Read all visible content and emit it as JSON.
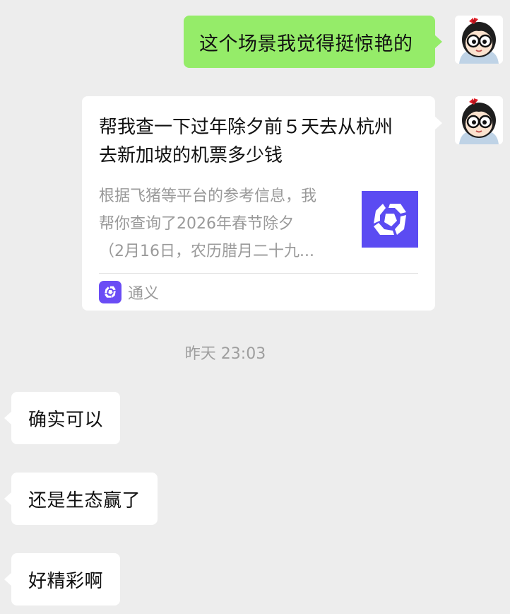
{
  "messages": {
    "outgoing_text": "这个场景我觉得挺惊艳的",
    "shared_card": {
      "title_line1": "帮我查一下过年除夕前５天去从杭州",
      "title_line2": "去新加坡的机票多少钱",
      "desc_line1": "根据飞猪等平台的参考信息，我",
      "desc_line2": "帮你查询了2026年春节除夕",
      "desc_line3": "（2月16日，农历腊月二十九...",
      "thumbnail_icon": "qwen-logo-icon",
      "source_name": "通义",
      "source_icon": "qwen-logo-icon"
    },
    "timestamp": "昨天 23:03",
    "incoming": [
      {
        "text": "确实可以"
      },
      {
        "text": "还是生态赢了"
      },
      {
        "text": "好精彩啊"
      }
    ]
  },
  "colors": {
    "background": "#EDEDED",
    "outgoing_bubble": "#95EC69",
    "incoming_bubble": "#FFFFFF",
    "brand_accent": "#5B4BF2"
  }
}
